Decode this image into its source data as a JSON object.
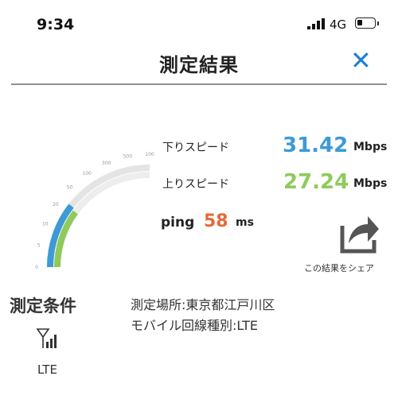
{
  "status_bar": {
    "time": "9:34",
    "network": "4G"
  },
  "header": {
    "title": "測定結果",
    "close_label": "✕"
  },
  "results": {
    "download": {
      "label": "下りスピード",
      "value": "31.42",
      "unit": "Mbps",
      "color": "#3d9ad6"
    },
    "upload": {
      "label": "上りスピード",
      "value": "27.24",
      "unit": "Mbps",
      "color": "#8fca5c"
    },
    "ping": {
      "label": "ping",
      "value": "58",
      "unit": "ms",
      "color": "#e8683a"
    }
  },
  "gauge": {
    "max": 1000,
    "ticks": [
      "0",
      "5",
      "10",
      "20",
      "50",
      "100",
      "300",
      "500",
      "100"
    ],
    "download_mbps": 31.42,
    "upload_mbps": 27.24
  },
  "share": {
    "label": "この結果をシェア",
    "icon": "share-icon"
  },
  "conditions": {
    "title": "測定条件",
    "location": "測定場所:東京都江戸川区",
    "line_type": "モバイル回線種別:LTE",
    "network_icon": "antenna-signal-icon",
    "network_label": "LTE"
  }
}
